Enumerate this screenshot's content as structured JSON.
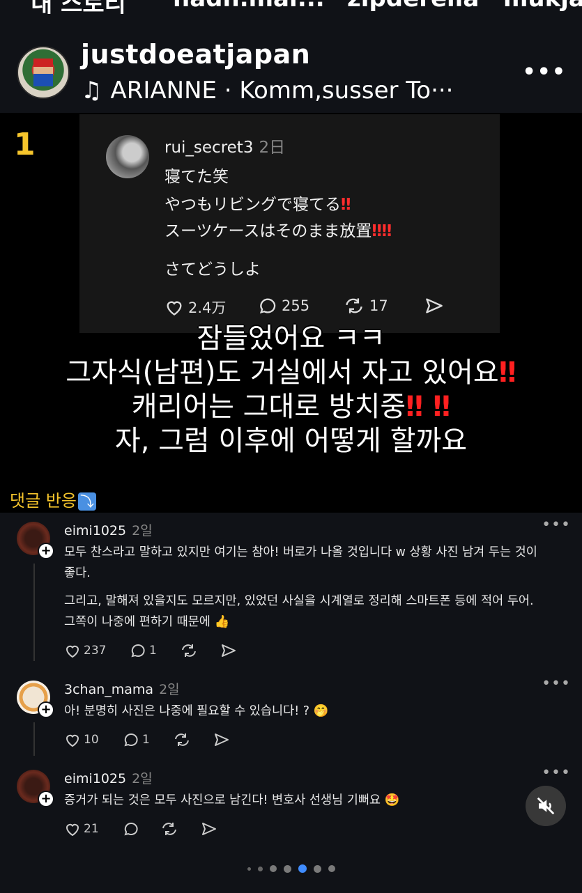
{
  "top_strip": {
    "items": [
      "내 스토리",
      "nadh.mar...",
      "zipderella",
      "mukja"
    ]
  },
  "post": {
    "username": "justdoeatjapan",
    "music": "ARIANNE · Komm,susser To···",
    "more": "•••"
  },
  "video": {
    "number_badge": "1",
    "quoted": {
      "username": "rui_secret3",
      "time": "2日",
      "lines": [
        {
          "text": "寝てた笑",
          "bang": ""
        },
        {
          "text": "やつもリビングで寝てる",
          "bang": "‼"
        },
        {
          "text": "スーツケースはそのまま放置",
          "bang": "‼‼"
        },
        {
          "text": "さてどうしよ",
          "bang": ""
        }
      ],
      "likes": "2.4万",
      "replies": "255",
      "reposts": "17"
    },
    "subtitles": [
      {
        "text": "잠들었어요 ㅋㅋ",
        "bang": ""
      },
      {
        "text": "그자식(남편)도 거실에서 자고 있어요",
        "bang": "‼"
      },
      {
        "text": "캐리어는 그대로 방치중",
        "bang": "‼ ‼"
      },
      {
        "text": "자, 그럼 이후에 어떻게 할까요",
        "bang": ""
      }
    ]
  },
  "reactions": {
    "label": "댓글 반응",
    "arrow": "⤵"
  },
  "comments": [
    {
      "user": "eimi1025",
      "time": "2일",
      "lines": [
        "모두 찬스라고 말하고 있지만 여기는 참아! 버로가 나올 것입니다 w 상황 사진 남겨 두는 것이",
        "좋다.",
        "",
        "그리고, 말해져 있을지도 모르지만, 있었던 사실을 시계열로 정리해 스마트폰 등에 적어 두어.",
        "그쪽이 나중에 편하기 때문에 👍"
      ],
      "likes": "237",
      "replies": "1"
    },
    {
      "user": "3chan_mama",
      "time": "2일",
      "lines": [
        "아! 분명히 사진은 나중에 필요할 수 있습니다! ? 🤭"
      ],
      "likes": "10",
      "replies": "1"
    },
    {
      "user": "eimi1025",
      "time": "2일",
      "lines": [
        "증거가 되는 것은 모두 사진으로 남긴다! 변호사 선생님 기뻐요 🤩"
      ],
      "likes": "21",
      "replies": ""
    }
  ],
  "colors": {
    "background": "#101217",
    "accent_yellow": "#f6c52c",
    "alert_red": "#ff2d2d"
  },
  "icons": [
    "heart-icon",
    "comment-icon",
    "repost-icon",
    "share-icon",
    "more-icon",
    "mute-icon",
    "plus-icon",
    "music-note-icon"
  ],
  "pager": {
    "total": 7,
    "active": 5
  }
}
